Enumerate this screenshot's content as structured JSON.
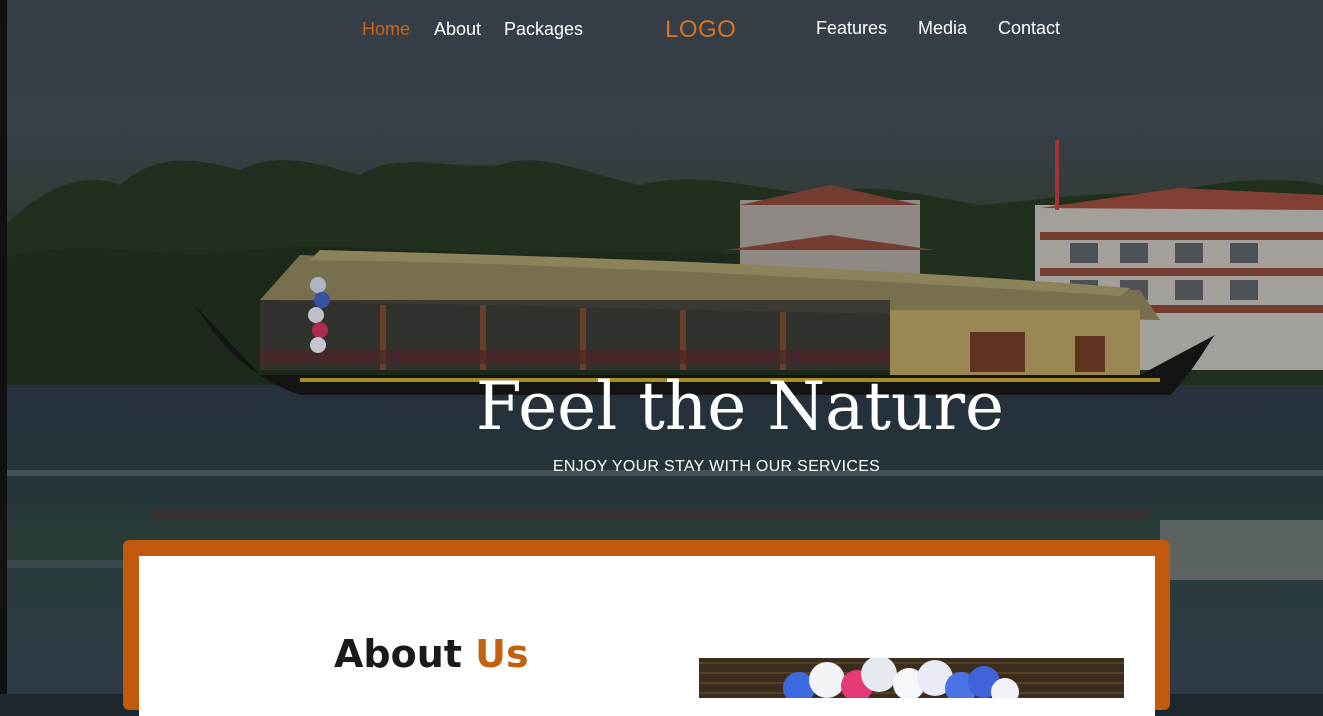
{
  "nav": {
    "left_items": [
      {
        "label": "Home",
        "active": true
      },
      {
        "label": "About",
        "active": false
      },
      {
        "label": "Packages",
        "active": false
      }
    ],
    "logo": "LOGO",
    "right_items": [
      {
        "label": "Features",
        "active": false
      },
      {
        "label": "Media",
        "active": false
      },
      {
        "label": "Contact",
        "active": false
      }
    ]
  },
  "hero": {
    "title": "Feel the Nature",
    "subtitle": "ENJOY YOUR STAY WITH OUR SERVICES"
  },
  "about": {
    "title_part1": "About",
    "title_part2": "Us"
  },
  "colors": {
    "accent": "#c8651b",
    "frame": "#c25a0e",
    "text_light": "#ffffff",
    "text_dark": "#1a1a1a"
  }
}
